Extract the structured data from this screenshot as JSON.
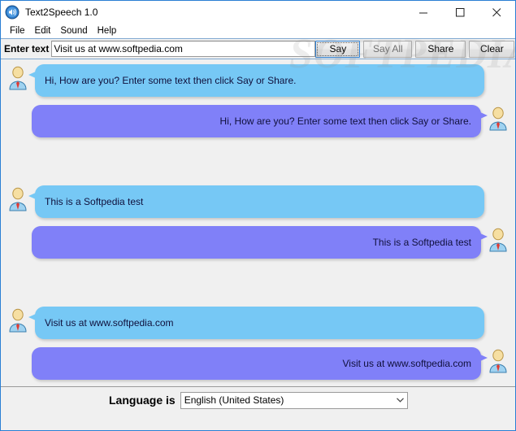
{
  "window": {
    "title": "Text2Speech 1.0",
    "app_icon": "speaker-icon",
    "controls": {
      "minimize": "minimize-icon",
      "maximize": "maximize-icon",
      "close": "close-icon"
    },
    "accent_color": "#2a7fd4"
  },
  "menubar": {
    "items": [
      {
        "label": "File"
      },
      {
        "label": "Edit"
      },
      {
        "label": "Sound"
      },
      {
        "label": "Help"
      }
    ]
  },
  "toolbar": {
    "enter_text_label": "Enter text",
    "input": {
      "value": "Visit us at www.softpedia.com",
      "placeholder": ""
    },
    "buttons": [
      {
        "label": "Say",
        "state": "focused"
      },
      {
        "label": "Say All",
        "state": "disabled"
      },
      {
        "label": "Share",
        "state": "normal"
      },
      {
        "label": "Clear",
        "state": "normal"
      }
    ]
  },
  "chat": {
    "background_color": "#f0f0f0",
    "incoming_bubble_color": "#76c8f5",
    "outgoing_bubble_color": "#8080f8",
    "messages": [
      {
        "direction": "in",
        "text": "Hi, How are you? Enter some text then click Say or Share."
      },
      {
        "direction": "out",
        "text": "Hi, How are you? Enter some text then click Say or Share."
      },
      {
        "direction": "in",
        "text": "This is a Softpedia test"
      },
      {
        "direction": "out",
        "text": "This is a Softpedia test"
      },
      {
        "direction": "in",
        "text": "Visit us at www.softpedia.com"
      },
      {
        "direction": "out",
        "text": "Visit us at www.softpedia.com"
      }
    ]
  },
  "bottombar": {
    "language_label": "Language is",
    "language_select": {
      "selected": "English (United States)",
      "options": [
        "English (United States)"
      ]
    }
  },
  "watermark": {
    "text": "SOFTPEDIA"
  }
}
